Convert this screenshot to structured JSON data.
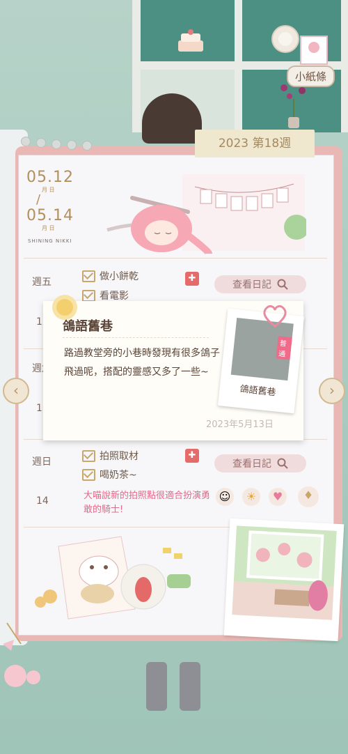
{
  "shelf": {
    "note_label": "小紙條"
  },
  "notebook": {
    "week_tab": "2023 第18週",
    "date_start": "05.12",
    "date_end": "05.14",
    "day_lbl": "月   日",
    "brand": "SHINING NIKKI",
    "rows": [
      {
        "day": "週五",
        "num": "12",
        "tasks": [
          "做小餅乾",
          "看電影"
        ],
        "diary_label": "查看日記"
      },
      {
        "day": "週六",
        "num": "13"
      },
      {
        "day": "週日",
        "num": "14",
        "tasks": [
          "拍照取材",
          "喝奶茶~"
        ],
        "diary_label": "查看日記",
        "comment": "大喵說新的拍照點很適合扮演勇敢的騎士!"
      }
    ]
  },
  "popup": {
    "title": "鴿語舊巷",
    "body": "路過教堂旁的小巷時發現有很多鴿子飛過呢，搭配的靈感又多了一些~",
    "date": "2023年5月13日",
    "photo_caption": "鴿語舊巷",
    "photo_badge": "普通"
  },
  "icons": {
    "nav_prev": "chevron-left-icon",
    "nav_next": "chevron-right-icon",
    "search": "search-icon"
  }
}
